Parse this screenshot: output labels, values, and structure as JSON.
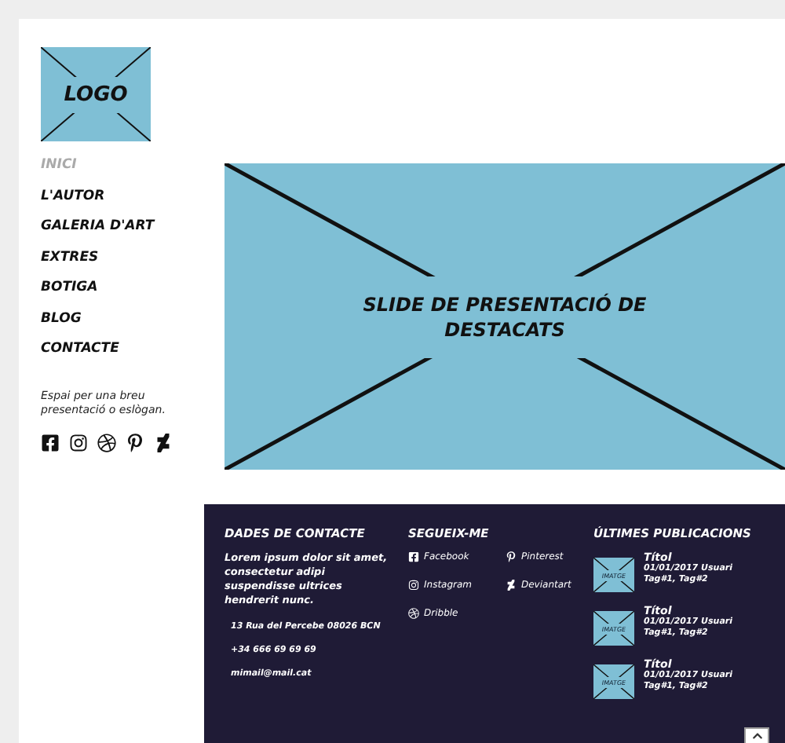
{
  "logo": {
    "text": "LOGO"
  },
  "nav": [
    {
      "label": "INICI",
      "selected": true
    },
    {
      "label": "L'AUTOR",
      "selected": false
    },
    {
      "label": "GALERIA D'ART",
      "selected": false
    },
    {
      "label": "EXTRES",
      "selected": false
    },
    {
      "label": "BOTIGA",
      "selected": false
    },
    {
      "label": "BLOG",
      "selected": false
    },
    {
      "label": "CONTACTE",
      "selected": false
    }
  ],
  "tagline": "Espai per una breu presentació o eslògan.",
  "social_icons": [
    {
      "kind": "facebook"
    },
    {
      "kind": "instagram"
    },
    {
      "kind": "dribbble"
    },
    {
      "kind": "pinterest"
    },
    {
      "kind": "deviantart"
    }
  ],
  "slide": {
    "title": "SLIDE DE PRESENTACIÓ DE DESTACATS"
  },
  "footer": {
    "contact": {
      "heading": "DADES DE CONTACTE",
      "text": "Lorem ipsum dolor sit amet, consectetur adipi suspendisse ultrices hendrerit nunc.",
      "address": "13 Rua del Percebe 08026 BCN",
      "phone": "+34 666 69 69 69",
      "email": "mimail@mail.cat"
    },
    "follow": {
      "heading": "SEGUEIX-ME",
      "links": [
        {
          "kind": "facebook",
          "label": "Facebook"
        },
        {
          "kind": "pinterest",
          "label": "Pinterest"
        },
        {
          "kind": "instagram",
          "label": "Instagram"
        },
        {
          "kind": "deviantart",
          "label": "Deviantart"
        },
        {
          "kind": "dribbble",
          "label": "Dribble"
        }
      ]
    },
    "posts": {
      "heading": "ÚLTIMES PUBLICACIONS",
      "items": [
        {
          "thumb": "IMATGE",
          "title": "Títol",
          "meta": "01/01/2017 Usuari",
          "tags": "Tag#1, Tag#2"
        },
        {
          "thumb": "IMATGE",
          "title": "Títol",
          "meta": "01/01/2017 Usuari",
          "tags": "Tag#1, Tag#2"
        },
        {
          "thumb": "IMATGE",
          "title": "Títol",
          "meta": "01/01/2017 Usuari",
          "tags": "Tag#1, Tag#2"
        }
      ]
    }
  }
}
